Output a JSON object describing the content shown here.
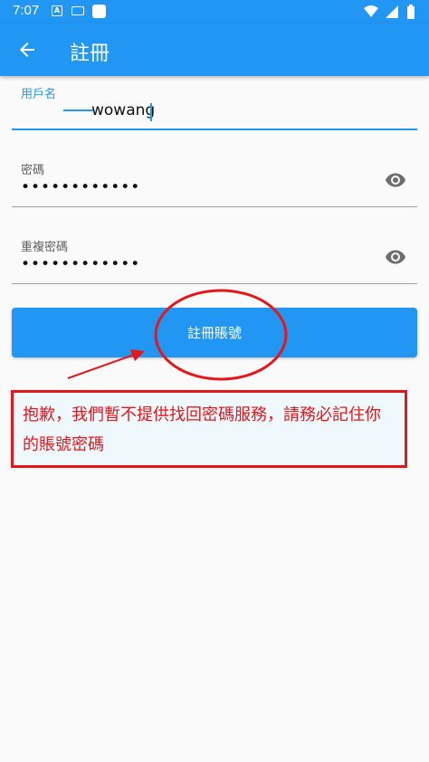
{
  "status_bar": {
    "time": "7:07"
  },
  "app_bar": {
    "title": "註冊"
  },
  "form": {
    "username": {
      "label": "用戶名",
      "value": "wowang"
    },
    "password": {
      "label": "密碼",
      "value": "••••••••••••"
    },
    "confirm_password": {
      "label": "重複密碼",
      "value": "••••••••••••"
    },
    "submit_label": "註冊賬號"
  },
  "notice": {
    "text": "抱歉，我們暫不提供找回密碼服務，請務必記住你的賬號密碼"
  },
  "colors": {
    "primary": "#2196f3",
    "annotation": "#e6171b"
  }
}
